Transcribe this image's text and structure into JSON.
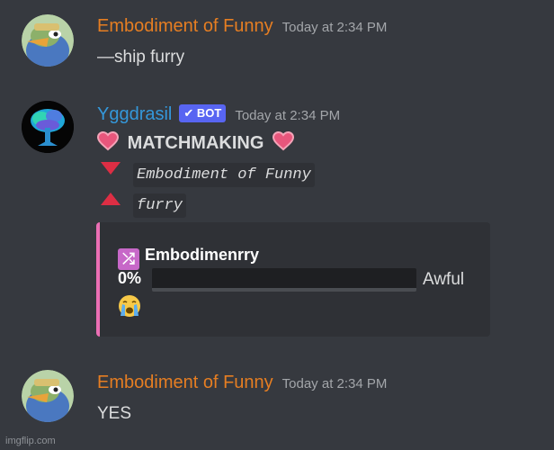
{
  "messages": [
    {
      "author": "Embodiment of Funny",
      "author_color": "#e67e22",
      "timestamp": "Today at 2:34 PM",
      "text": "—ship furry"
    },
    {
      "author": "Yggdrasil",
      "author_color": "#3498db",
      "bot_tag": "✔ BOT",
      "timestamp": "Today at 2:34 PM",
      "heading": "MATCHMAKING",
      "name1": "Embodiment of Funny",
      "name2": "furry",
      "embed": {
        "title": "Embodimenrry",
        "percent": "0%",
        "percent_value": 0,
        "rating": "Awful",
        "border_color": "#eb6fb4"
      }
    },
    {
      "author": "Embodiment of Funny",
      "author_color": "#e67e22",
      "timestamp": "Today at 2:34 PM",
      "text": "YES"
    }
  ],
  "watermark": "imgflip.com"
}
